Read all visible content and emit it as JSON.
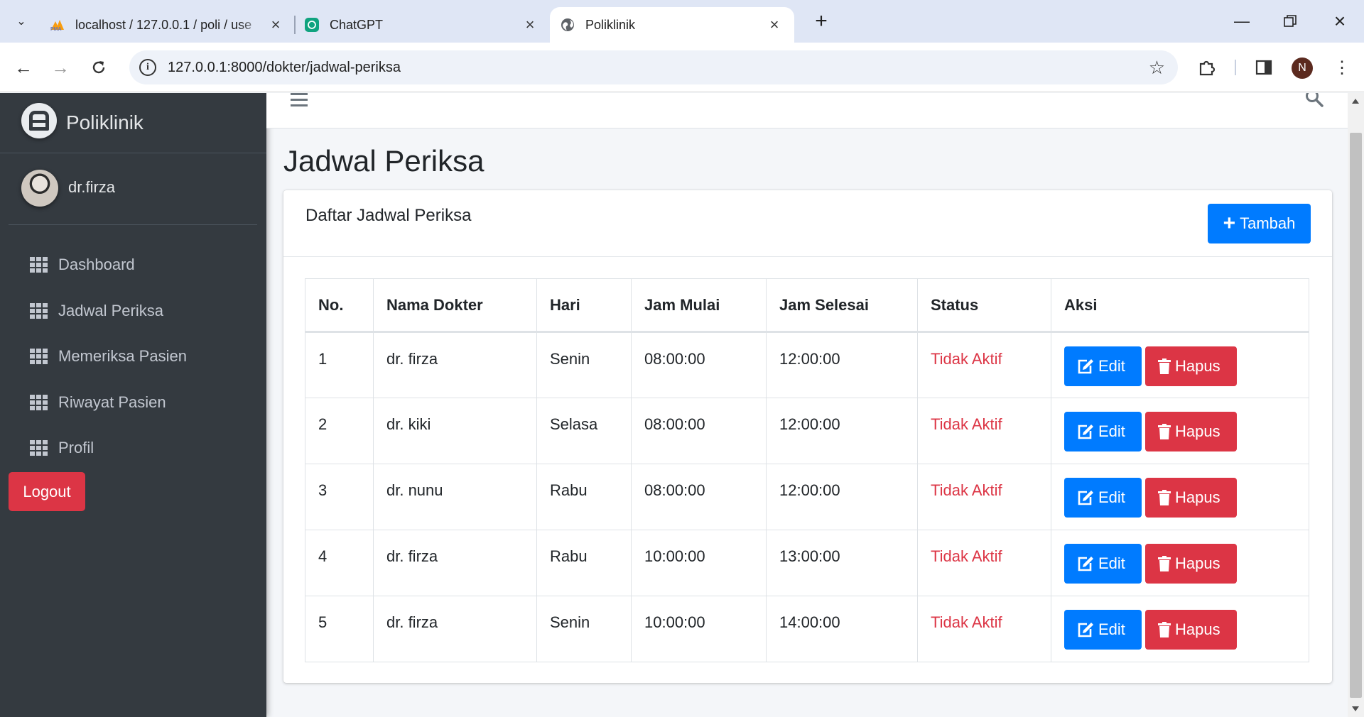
{
  "browser": {
    "tabs": [
      {
        "title": "localhost / 127.0.0.1 / poli / use",
        "favicon": "phpmyadmin-icon"
      },
      {
        "title": "ChatGPT",
        "favicon": "chatgpt-icon"
      },
      {
        "title": "Poliklinik",
        "favicon": "globe-icon"
      }
    ],
    "url": "127.0.0.1:8000/dokter/jadwal-periksa",
    "profile_initial": "N"
  },
  "sidebar": {
    "brand": "Poliklinik",
    "user": "dr.firza",
    "items": [
      {
        "label": "Dashboard"
      },
      {
        "label": "Jadwal Periksa"
      },
      {
        "label": "Memeriksa Pasien"
      },
      {
        "label": "Riwayat Pasien"
      },
      {
        "label": "Profil"
      }
    ],
    "logout": "Logout"
  },
  "main": {
    "page_title": "Jadwal Periksa",
    "card_title": "Daftar Jadwal Periksa",
    "add_button": "Tambah",
    "table": {
      "headers": [
        "No.",
        "Nama Dokter",
        "Hari",
        "Jam Mulai",
        "Jam Selesai",
        "Status",
        "Aksi"
      ],
      "rows": [
        {
          "no": "1",
          "dokter": "dr. firza",
          "hari": "Senin",
          "mulai": "08:00:00",
          "selesai": "12:00:00",
          "status": "Tidak Aktif"
        },
        {
          "no": "2",
          "dokter": "dr. kiki",
          "hari": "Selasa",
          "mulai": "08:00:00",
          "selesai": "12:00:00",
          "status": "Tidak Aktif"
        },
        {
          "no": "3",
          "dokter": "dr. nunu",
          "hari": "Rabu",
          "mulai": "08:00:00",
          "selesai": "12:00:00",
          "status": "Tidak Aktif"
        },
        {
          "no": "4",
          "dokter": "dr. firza",
          "hari": "Rabu",
          "mulai": "10:00:00",
          "selesai": "13:00:00",
          "status": "Tidak Aktif"
        },
        {
          "no": "5",
          "dokter": "dr. firza",
          "hari": "Senin",
          "mulai": "10:00:00",
          "selesai": "14:00:00",
          "status": "Tidak Aktif"
        }
      ],
      "edit_label": "Edit",
      "delete_label": "Hapus"
    }
  },
  "colors": {
    "primary": "#007bff",
    "danger": "#dc3545",
    "sidebar": "#343a40"
  }
}
